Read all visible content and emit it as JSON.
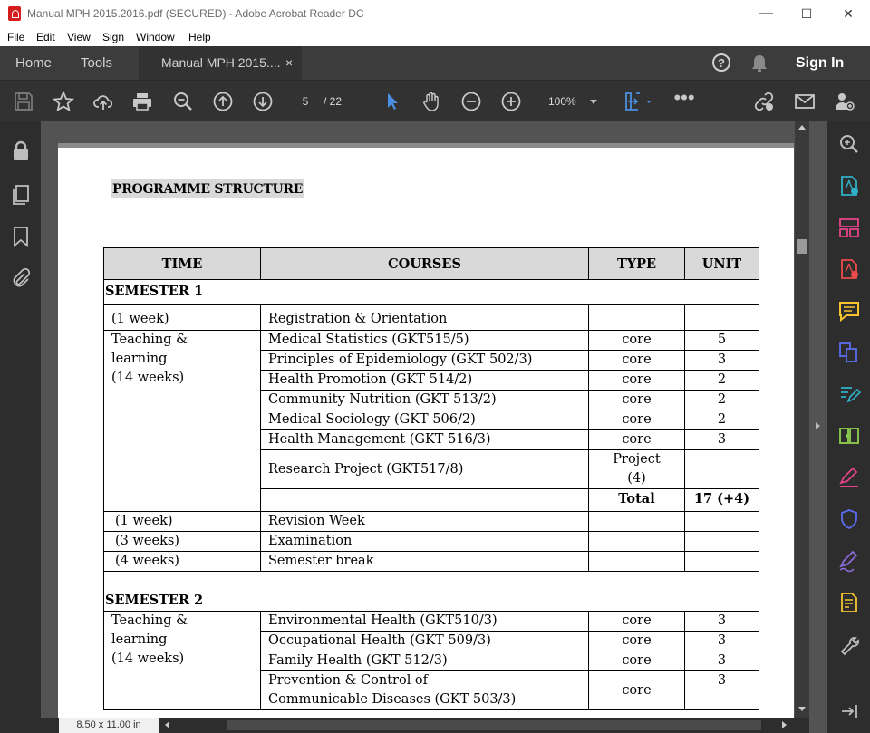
{
  "window": {
    "title": "Manual MPH 2015.2016.pdf (SECURED) - Adobe Acrobat Reader DC",
    "minimize": "—",
    "maximize": "☐",
    "close": "✕"
  },
  "menu": [
    "File",
    "Edit",
    "View",
    "Sign",
    "Window",
    "Help"
  ],
  "tabs": {
    "home": "Home",
    "tools": "Tools",
    "document": "Manual MPH 2015....",
    "close": "×",
    "sign_in": "Sign In"
  },
  "toolbar": {
    "current_page": "5",
    "total_pages": "/ 22",
    "zoom": "100%"
  },
  "status": {
    "page_size": "8.50 x 11.00 in"
  },
  "document": {
    "heading": "PROGRAMME STRUCTURE",
    "columns": [
      "TIME",
      "COURSES",
      "TYPE",
      "UNIT"
    ],
    "semester1": {
      "label": "SEMESTER 1",
      "registration": {
        "time": "(1  week)",
        "course": "Registration & Orientation"
      },
      "teaching_time_lines": [
        "Teaching &",
        "learning",
        "(14 weeks)"
      ],
      "courses": [
        {
          "course": "Medical Statistics  (GKT515/5)",
          "type": "core",
          "unit": "5"
        },
        {
          "course": "Principles of Epidemiology (GKT 502/3)",
          "type": "core",
          "unit": "3"
        },
        {
          "course": "Health Promotion (GKT 514/2)",
          "type": "core",
          "unit": "2"
        },
        {
          "course": "Community Nutrition (GKT 513/2)",
          "type": "core",
          "unit": "2"
        },
        {
          "course": "Medical Sociology (GKT 506/2)",
          "type": "core",
          "unit": "2"
        },
        {
          "course": "Health Management (GKT 516/3)",
          "type": "core",
          "unit": "3"
        }
      ],
      "project": {
        "course": "Research Project (GKT517/8)",
        "type_line1": "Project",
        "type_line2": "(4)",
        "unit": ""
      },
      "total": {
        "label": "Total",
        "value": "17 (+4)"
      },
      "after": [
        {
          "time": "(1  week)",
          "course": "Revision Week"
        },
        {
          "time": "(3 weeks)",
          "course": "Examination"
        },
        {
          "time": "(4 weeks)",
          "course": "Semester break"
        }
      ]
    },
    "semester2": {
      "label": "SEMESTER 2",
      "teaching_time_lines": [
        "Teaching &",
        "learning",
        "(14 weeks)"
      ],
      "courses": [
        {
          "course": "Environmental Health (GKT510/3)",
          "type": "core",
          "unit": "3"
        },
        {
          "course": "Occupational Health (GKT 509/3)",
          "type": "core",
          "unit": "3"
        },
        {
          "course": "Family Health (GKT 512/3)",
          "type": "core",
          "unit": "3"
        }
      ],
      "last": {
        "course_line1": "Prevention & Control of",
        "course_line2": "Communicable  Diseases  (GKT 503/3)",
        "type": "core",
        "unit": "3"
      }
    }
  }
}
